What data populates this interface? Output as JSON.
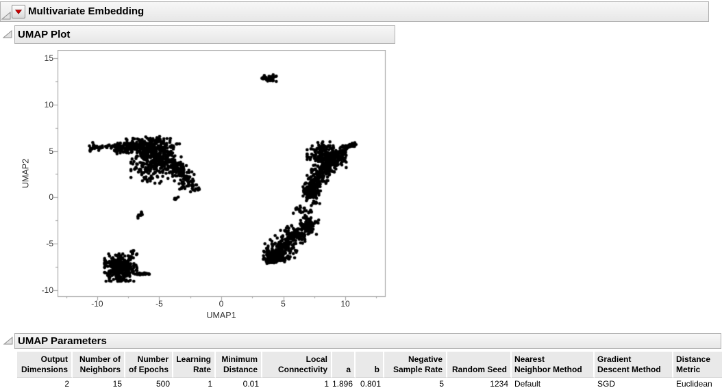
{
  "report": {
    "title": "Multivariate Embedding"
  },
  "sections": {
    "plot_title": "UMAP Plot",
    "parameters_title": "UMAP Parameters"
  },
  "icons": {
    "disclosure_open": "open-outline-triangle",
    "red_triangle_menu": "▼"
  },
  "colors": {
    "accent_red": "#cc0000",
    "bar_border": "#b0b0b0",
    "axis_gray": "#9e9e9e",
    "marker": "#000000"
  },
  "chart_data": {
    "type": "scatter",
    "title": "UMAP Plot",
    "xlabel": "UMAP1",
    "ylabel": "UMAP2",
    "grid": false,
    "legend": "none",
    "x_axis": {
      "min": -13.2,
      "max": 13.2,
      "major_ticks": [
        -10,
        -5,
        0,
        5,
        10
      ],
      "minor_ticks": [
        -12.5,
        -7.5,
        -2.5,
        2.5,
        7.5,
        12.5
      ]
    },
    "y_axis": {
      "min": -10.7,
      "max": 15.9,
      "major_ticks": [
        15,
        10,
        5,
        0,
        -5,
        -10
      ],
      "minor_ticks": [
        12.5,
        7.5,
        2.5,
        -2.5,
        -7.5
      ]
    },
    "marker": {
      "color": "#000000",
      "radius": 2.3
    },
    "seed": 20240613,
    "clusters": [
      {
        "name": "top-small-cluster",
        "kind": "gauss",
        "cx": 3.85,
        "cy": 12.8,
        "sx": 0.28,
        "sy": 0.2,
        "n": 40
      },
      {
        "name": "left-arc-tail-blob",
        "kind": "gauss",
        "cx": -10.2,
        "cy": 5.4,
        "sx": 0.22,
        "sy": 0.26,
        "n": 18
      },
      {
        "name": "left-arc-tail-line",
        "kind": "curve",
        "p": [
          [
            -10.0,
            5.35
          ],
          [
            -9.1,
            5.55
          ],
          [
            -8.1,
            5.45
          ]
        ],
        "th": [
          0.12,
          0.15,
          0.2
        ],
        "n": 28
      },
      {
        "name": "left-arc-top-band",
        "kind": "curve",
        "p": [
          [
            -8.4,
            5.2
          ],
          [
            -6.3,
            6.2
          ],
          [
            -4.0,
            5.2
          ]
        ],
        "th": [
          0.6,
          0.85,
          0.9
        ],
        "n": 300
      },
      {
        "name": "left-arc-diag-band",
        "kind": "curve",
        "p": [
          [
            -6.4,
            4.8
          ],
          [
            -3.9,
            4.3
          ],
          [
            -2.5,
            1.0
          ]
        ],
        "th": [
          0.9,
          1.05,
          0.6
        ],
        "n": 330
      },
      {
        "name": "left-arc-fill",
        "kind": "gauss",
        "cx": -5.6,
        "cy": 3.4,
        "sx": 0.8,
        "sy": 0.9,
        "n": 160
      },
      {
        "name": "left-arc-tip-dot-1",
        "kind": "gauss",
        "cx": -3.7,
        "cy": -0.15,
        "sx": 0.14,
        "sy": 0.12,
        "n": 7
      },
      {
        "name": "left-arc-tip-dot-2",
        "kind": "gauss",
        "cx": -2.0,
        "cy": 0.9,
        "sx": 0.16,
        "sy": 0.14,
        "n": 8
      },
      {
        "name": "small-mid-cluster",
        "kind": "curve",
        "p": [
          [
            -6.75,
            -2.3
          ],
          [
            -6.55,
            -1.9
          ],
          [
            -6.3,
            -1.5
          ]
        ],
        "th": [
          0.1,
          0.13,
          0.1
        ],
        "n": 10
      },
      {
        "name": "bottom-left-blob",
        "kind": "gauss",
        "cx": -8.1,
        "cy": -7.6,
        "sx": 0.62,
        "sy": 0.7,
        "n": 330
      },
      {
        "name": "bottom-left-tail",
        "kind": "curve",
        "p": [
          [
            -7.0,
            -8.25
          ],
          [
            -6.4,
            -8.3
          ],
          [
            -5.8,
            -8.3
          ]
        ],
        "th": [
          0.12,
          0.14,
          0.12
        ],
        "n": 22
      },
      {
        "name": "bottom-left-spike",
        "kind": "curve",
        "p": [
          [
            -7.4,
            -6.8
          ],
          [
            -7.3,
            -6.2
          ],
          [
            -7.15,
            -5.8
          ]
        ],
        "th": [
          0.14,
          0.14,
          0.1
        ],
        "n": 14
      },
      {
        "name": "right-lower-diagonal",
        "kind": "curve",
        "p": [
          [
            3.9,
            -6.7
          ],
          [
            5.1,
            -4.9
          ],
          [
            7.5,
            -2.7
          ]
        ],
        "th": [
          0.55,
          1.0,
          1.15,
          0.95,
          0.5
        ],
        "n": 430
      },
      {
        "name": "right-lower-tip",
        "kind": "gauss",
        "cx": 4.0,
        "cy": -6.8,
        "sx": 0.38,
        "sy": 0.3,
        "n": 34
      },
      {
        "name": "right-lower-tip-2",
        "kind": "gauss",
        "cx": 5.3,
        "cy": -6.6,
        "sx": 0.22,
        "sy": 0.18,
        "n": 12
      },
      {
        "name": "connector-dot-1",
        "kind": "gauss",
        "cx": 6.25,
        "cy": -1.3,
        "sx": 0.22,
        "sy": 0.3,
        "n": 14
      },
      {
        "name": "connector-dot-2",
        "kind": "gauss",
        "cx": 7.6,
        "cy": -0.6,
        "sx": 0.16,
        "sy": 0.16,
        "n": 8
      },
      {
        "name": "connector-dot-3",
        "kind": "gauss",
        "cx": 7.15,
        "cy": -1.5,
        "sx": 0.14,
        "sy": 0.14,
        "n": 7
      },
      {
        "name": "connector-dot-4",
        "kind": "gauss",
        "cx": 6.9,
        "cy": -2.15,
        "sx": 0.16,
        "sy": 0.14,
        "n": 7
      },
      {
        "name": "right-upper-main",
        "kind": "curve",
        "p": [
          [
            7.1,
            0.1
          ],
          [
            7.7,
            2.8
          ],
          [
            9.5,
            4.7
          ]
        ],
        "th": [
          0.55,
          0.9,
          0.95
        ],
        "n": 330
      },
      {
        "name": "right-upper-fill",
        "kind": "gauss",
        "cx": 8.5,
        "cy": 4.3,
        "sx": 0.75,
        "sy": 0.6,
        "n": 150
      },
      {
        "name": "right-upper-top",
        "kind": "gauss",
        "cx": 8.1,
        "cy": 5.3,
        "sx": 0.45,
        "sy": 0.32,
        "n": 40
      },
      {
        "name": "right-upper-arm",
        "kind": "curve",
        "p": [
          [
            9.5,
            4.7
          ],
          [
            10.2,
            5.5
          ],
          [
            10.85,
            5.75
          ]
        ],
        "th": [
          0.42,
          0.36,
          0.28
        ],
        "n": 60
      },
      {
        "name": "right-upper-bottom-dot",
        "kind": "gauss",
        "cx": 7.6,
        "cy": 0.2,
        "sx": 0.2,
        "sy": 0.15,
        "n": 8
      }
    ]
  },
  "parameters_table": {
    "columns": [
      {
        "header": [
          "Output",
          "Dimensions"
        ],
        "value": "2",
        "align": "right"
      },
      {
        "header": [
          "Number of",
          "Neighbors"
        ],
        "value": "15",
        "align": "right"
      },
      {
        "header": [
          "Number",
          "of Epochs"
        ],
        "value": "500",
        "align": "right"
      },
      {
        "header": [
          "Learning",
          "Rate"
        ],
        "value": "1",
        "align": "right"
      },
      {
        "header": [
          "Minimum",
          "Distance"
        ],
        "value": "0.01",
        "align": "right"
      },
      {
        "header": [
          "Local",
          "Connectivity"
        ],
        "value": "1",
        "align": "right"
      },
      {
        "header": [
          "",
          "a"
        ],
        "value": "1.896",
        "align": "right"
      },
      {
        "header": [
          "",
          "b"
        ],
        "value": "0.801",
        "align": "right"
      },
      {
        "header": [
          "Negative",
          "Sample Rate"
        ],
        "value": "5",
        "align": "right"
      },
      {
        "header": [
          "",
          "Random Seed"
        ],
        "value": "1234",
        "align": "right"
      },
      {
        "header": [
          "Nearest",
          "Neighbor Method"
        ],
        "value": "Default",
        "align": "left"
      },
      {
        "header": [
          "Gradient",
          "Descent Method"
        ],
        "value": "SGD",
        "align": "left"
      },
      {
        "header": [
          "Distance",
          "Metric"
        ],
        "value": "Euclidean",
        "align": "left"
      }
    ]
  }
}
